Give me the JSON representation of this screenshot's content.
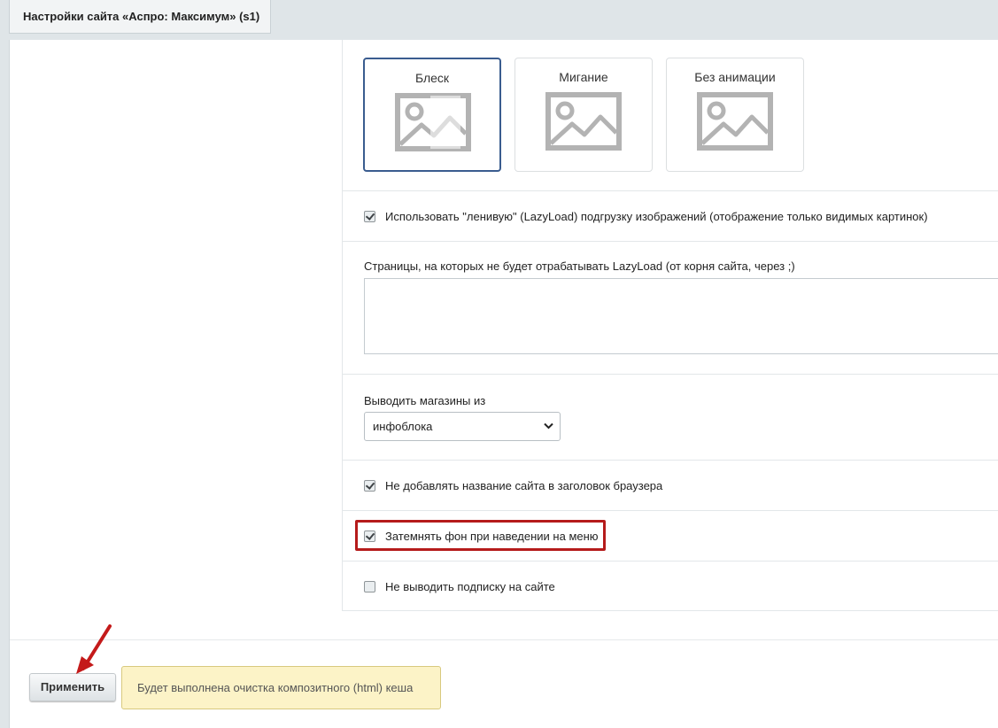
{
  "tab": {
    "title": "Настройки сайта «Аспро: Максимум» (s1)"
  },
  "animation_options": [
    {
      "label": "Блеск",
      "selected": true
    },
    {
      "label": "Мигание",
      "selected": false
    },
    {
      "label": "Без анимации",
      "selected": false
    }
  ],
  "lazyload": {
    "label": "Использовать \"ленивую\" (LazyLoad) подгрузку изображений (отображение только видимых картинок)",
    "checked": true
  },
  "exclude_pages": {
    "label": "Страницы, на которых не будет отрабатывать LazyLoad (от корня сайта, через ;)",
    "value": ""
  },
  "stores_source": {
    "label": "Выводить магазины из",
    "selected": "инфоблока"
  },
  "no_site_title": {
    "label": "Не добавлять название сайта в заголовок браузера",
    "checked": true
  },
  "darken_bg": {
    "label": "Затемнять фон при наведении на меню",
    "checked": true
  },
  "no_subscribe": {
    "label": "Не выводить подписку на сайте",
    "checked": false
  },
  "footer": {
    "apply_label": "Применить",
    "note": "Будет выполнена очистка композитного (html) кеша"
  },
  "colors": {
    "selected_border": "#3a5c8f",
    "highlight": "#b51b1b",
    "note_bg": "#fcf3c7"
  },
  "icons": {
    "image_placeholder": "image-placeholder-icon",
    "arrow": "red-arrow-icon"
  }
}
